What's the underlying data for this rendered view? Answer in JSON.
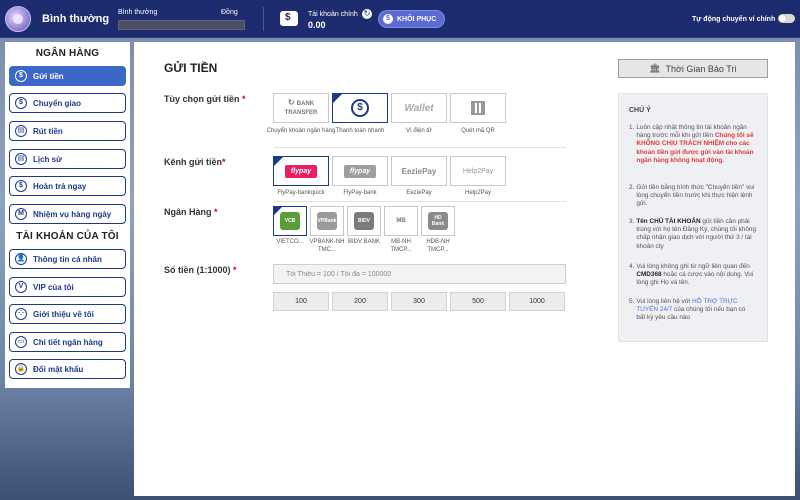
{
  "header": {
    "level_name": "Bình thường",
    "progress_left": "Bình thường",
    "progress_right": "Đồng",
    "account_label": "Tài khoản chính",
    "balance": "0.00",
    "restore_label": "KHÔI PHỤC",
    "auto_transfer_label": "Tự động chuyển ví chính",
    "auto_transfer_on": false
  },
  "sidebar": {
    "bank_heading": "NGÂN HÀNG",
    "account_heading": "TÀI KHOẢN CỦA TÔI",
    "bank_items": [
      {
        "label": "Gửi tiền",
        "icon": "$"
      },
      {
        "label": "Chuyển giao",
        "icon": "$"
      },
      {
        "label": "Rút tiền",
        "icon": "▤"
      },
      {
        "label": "Lịch sử",
        "icon": "▤"
      },
      {
        "label": "Hoàn trả ngay",
        "icon": "$"
      },
      {
        "label": "Nhiệm vụ hàng ngày",
        "icon": "M"
      }
    ],
    "account_items": [
      {
        "label": "Thông tin cá nhân",
        "icon": "👤"
      },
      {
        "label": "VIP của tôi",
        "icon": "V"
      },
      {
        "label": "Giới thiệu về tôi",
        "icon": "⁘"
      },
      {
        "label": "Chi tiết ngân hàng",
        "icon": "▭"
      },
      {
        "label": "Đổi mật khẩu",
        "icon": "🔒"
      }
    ]
  },
  "main": {
    "title": "GỬI TIỀN",
    "maintenance_label": "Thời Gian Bảo Trì",
    "deposit_option_label": "Tùy chọn gửi tiền",
    "deposit_options": [
      {
        "caption": "Chuyển khoản ngân hàng",
        "logo": "BANK TRANSFER",
        "selected": false
      },
      {
        "caption": "Thanh toán nhanh",
        "logo": "$",
        "selected": true
      },
      {
        "caption": "Ví điện tử",
        "logo": "Wallet",
        "selected": false
      },
      {
        "caption": "Quét mã QR",
        "logo": "QR",
        "selected": false
      }
    ],
    "channel_label": "Kênh gửi tiền",
    "channels": [
      {
        "caption": "FlyPay-bankquick",
        "logo": "flypay",
        "selected": true
      },
      {
        "caption": "FlyPay-bank",
        "logo": "flypay",
        "selected": false
      },
      {
        "caption": "EeziePay",
        "logo": "EeziePay",
        "selected": false
      },
      {
        "caption": "Help2Pay",
        "logo": "Help2Pay",
        "selected": false
      }
    ],
    "bank_label": "Ngân Hàng",
    "banks": [
      {
        "caption": "VIETCO...",
        "logo": "VCB",
        "color": "#5a9e3c",
        "selected": true
      },
      {
        "caption": "VPBANK-NH TMC...",
        "logo": "VPBank",
        "color": "#9a9a9a",
        "selected": false
      },
      {
        "caption": "BIDV BANK",
        "logo": "BIDV",
        "color": "#7a7a7a",
        "selected": false
      },
      {
        "caption": "MB-NH TMCP...",
        "logo": "MB",
        "color": "#bdbdbd",
        "selected": false
      },
      {
        "caption": "HDB-NH TMCP...",
        "logo": "HD Bank",
        "color": "#8a8a8a",
        "selected": false
      }
    ],
    "amount_label": "Số tiền (1:1000)",
    "amount_placeholder": "Tối Thiểu = 100 / Tối đa = 100000",
    "quick_amounts": [
      "100",
      "200",
      "300",
      "500",
      "1000"
    ]
  },
  "notes": {
    "title": "CHÚ Ý",
    "items": [
      {
        "num": "1.",
        "pre": "Luôn cập nhật thông tin tài khoản ngân hàng trước mỗi khi gửi tiền ",
        "red": "Chúng tôi sẽ KHÔNG CHỊU TRÁCH NHIỆM cho các khoản tiền gửi được gửi vào tài khoản ngân hàng không hoạt động."
      },
      {
        "num": "2.",
        "pre": "Gửi tiền bằng hình thức \"Chuyển tiền\" vui lòng chuyển tiền trước khi thực hiện lệnh gửi."
      },
      {
        "num": "3.",
        "bold": "Tên CHỦ TÀI KHOẢN",
        "pre": " gửi tiền cần phải trùng với họ tên Đăng Ký, chúng tôi không chấp nhận giao dịch với người thứ 3 / tài khoản cty"
      },
      {
        "num": "4.",
        "pre": "Vui lòng không ghi từ ngữ liên quan đến ",
        "bold": "CMD368",
        "post": " hoặc cá cược vào nội dung. Vui lòng ghi Họ và tên."
      },
      {
        "num": "5.",
        "pre": "Vui lòng liên hệ với ",
        "link": "HỖ TRỢ TRỰC TUYẾN 24/7",
        "post": " của chúng tôi nếu bạn có bất kỳ yêu cầu nào"
      }
    ]
  },
  "colors": {
    "header_bg": "#1d2c6e",
    "accent": "#3b67c6",
    "nav_border": "#1d3a8a",
    "warning_red": "#e53935"
  }
}
